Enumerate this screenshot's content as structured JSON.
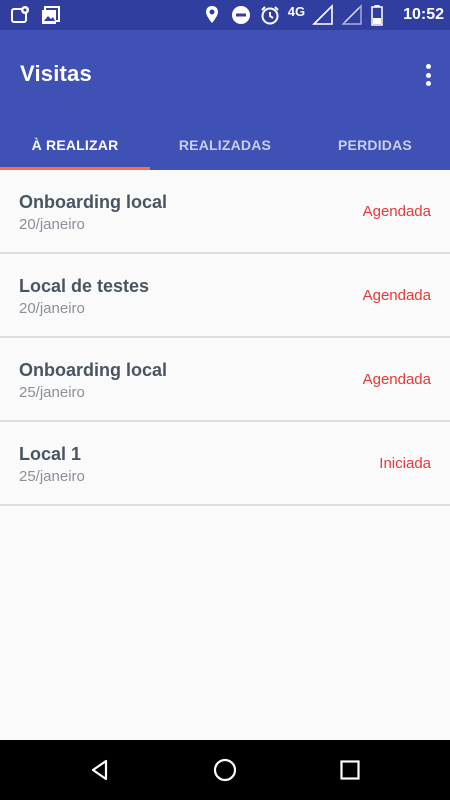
{
  "status_bar": {
    "network": "4G",
    "time": "10:52",
    "icons": [
      "location-notification-icon",
      "gallery-notification-icon",
      "location-icon",
      "do-not-disturb-icon",
      "alarm-icon",
      "signal-icon",
      "signal-empty-icon",
      "battery-icon"
    ]
  },
  "app_bar": {
    "title": "Visitas",
    "menu_icon": "more-vert-icon"
  },
  "tabs": [
    {
      "label": "À REALIZAR",
      "active": true
    },
    {
      "label": "REALIZADAS",
      "active": false
    },
    {
      "label": "PERDIDAS",
      "active": false
    }
  ],
  "colors": {
    "status_bar": "#303f9f",
    "app_bar": "#3f51b5",
    "tab_indicator": "#ff6e40",
    "status_text": "#e53935"
  },
  "visits": [
    {
      "title": "Onboarding local",
      "date": "20/janeiro",
      "status": "Agendada"
    },
    {
      "title": "Local de testes",
      "date": "20/janeiro",
      "status": "Agendada"
    },
    {
      "title": "Onboarding local",
      "date": "25/janeiro",
      "status": "Agendada"
    },
    {
      "title": "Local 1",
      "date": "25/janeiro",
      "status": "Iniciada"
    }
  ],
  "nav_bar": {
    "icons": [
      "back-icon",
      "home-icon",
      "recents-icon"
    ]
  }
}
